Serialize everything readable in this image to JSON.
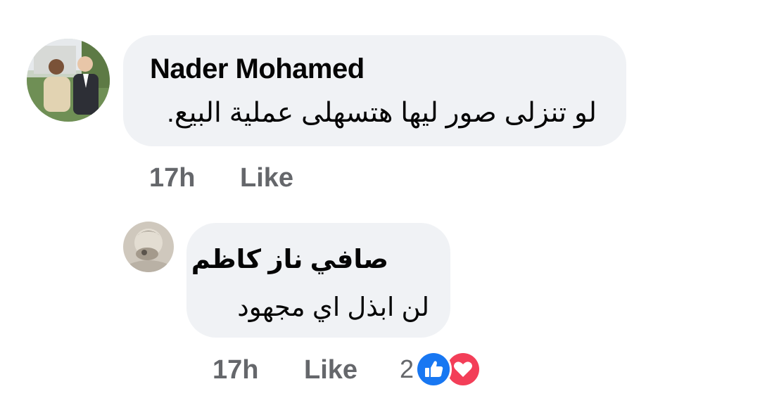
{
  "comments": [
    {
      "author": "Nader Mohamed",
      "text": "لو تنزلى صور ليها هتسهلى عملية البيع.",
      "time": "17h",
      "like_label": "Like"
    },
    {
      "author": "صافي ناز كاظم",
      "text": "لن ابذل اي مجهود",
      "time": "17h",
      "like_label": "Like",
      "reaction_count": "2",
      "reactions": [
        "like-reaction-icon",
        "love-reaction-icon"
      ]
    }
  ],
  "colors": {
    "bubble": "#f0f2f5",
    "meta_text": "#65676b",
    "like_blue": "#1877f2",
    "love_red": "#f33e58"
  }
}
